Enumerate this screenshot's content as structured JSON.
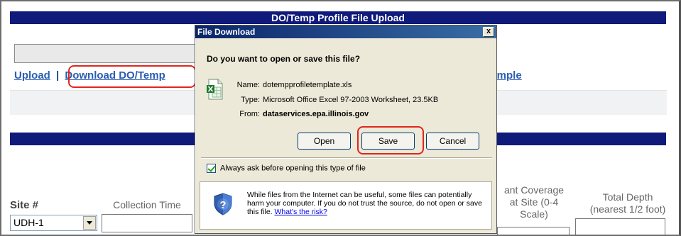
{
  "page": {
    "title": "DO/Temp Profile File Upload",
    "links": {
      "upload": "Upload",
      "separator": "|",
      "download": "Download DO/Temp",
      "example": "xample"
    },
    "columns": {
      "site": "Site #",
      "collection_time": "Collection Time",
      "plant_coverage": "ant Coverage\nat Site (0-4\nScale)",
      "total_depth": "Total Depth\n(nearest 1/2 foot)"
    },
    "site_select_value": "UDH-1"
  },
  "dialog": {
    "title": "File Download",
    "close_glyph": "x",
    "question": "Do you want to open or save this file?",
    "name_label": "Name:",
    "name_value": "dotempprofiletemplate.xls",
    "type_label": "Type:",
    "type_value": "Microsoft Office Excel 97-2003 Worksheet, 23.5KB",
    "from_label": "From:",
    "from_value": "dataservices.epa.illinois.gov",
    "buttons": {
      "open": "Open",
      "save": "Save",
      "cancel": "Cancel"
    },
    "checkbox_label": "Always ask before opening this type of file",
    "warning_text": "While files from the Internet can be useful, some files can potentially harm your computer. If you do not trust the source, do not open or save this file. ",
    "warning_link": "What's the risk?",
    "icons": [
      "excel-file-icon",
      "shield-question-icon"
    ]
  },
  "colors": {
    "title_bar": "#0f1a7a",
    "link": "#2a5db0",
    "highlight": "#e3241c",
    "dialog_bg": "#ece9d8"
  }
}
